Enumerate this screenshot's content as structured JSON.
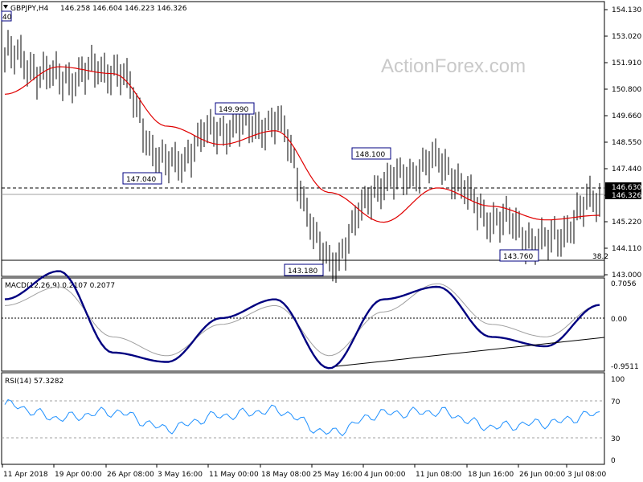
{
  "header": {
    "symbol": "GBPJPY,H4",
    "ohlc": "146.258 146.604 146.223 146.326",
    "corner_label": "40"
  },
  "watermark": "ActionForex.com",
  "colors": {
    "candles": "#000000",
    "moving_average": "#e00000",
    "macd_line": "#000080",
    "macd_signal": "#a0a0a0",
    "rsi_line": "#1e90ff",
    "label_box_border": "#000080",
    "price_box": "#000000"
  },
  "price_panel": {
    "price_axis_ticks": [
      "154.130",
      "153.020",
      "151.910",
      "150.800",
      "149.660",
      "148.550",
      "147.440",
      "146.330",
      "145.220",
      "144.110",
      "143.000"
    ],
    "current_price_high": "146.630",
    "current_price": "146.326",
    "annotations": [
      "149.990",
      "147.040",
      "148.100",
      "143.180",
      "143.760"
    ],
    "level_label": "38.2"
  },
  "macd_panel": {
    "title": "MACD(12,26,9) 0.2107 0.2077",
    "axis_ticks": [
      "0.7056",
      "0.00",
      "-0.9511"
    ]
  },
  "rsi_panel": {
    "title": "RSI(14) 57.3282",
    "axis_ticks": [
      "100",
      "70",
      "30",
      "0"
    ]
  },
  "time_axis": [
    "11 Apr 2018",
    "19 Apr 00:00",
    "26 Apr 08:00",
    "3 May 16:00",
    "11 May 00:00",
    "18 May 08:00",
    "25 May 16:00",
    "4 Jun 00:00",
    "11 Jun 08:00",
    "18 Jun 16:00",
    "26 Jun 00:00",
    "3 Jul 08:00"
  ],
  "chart_data": [
    {
      "type": "line",
      "title": "GBPJPY,H4",
      "description_values": "approximate closing path read from candles",
      "x": [
        "11 Apr 2018",
        "19 Apr 00:00",
        "26 Apr 08:00",
        "3 May 16:00",
        "11 May 00:00",
        "18 May 08:00",
        "25 May 16:00",
        "4 Jun 00:00",
        "11 Jun 08:00",
        "18 Jun 16:00",
        "26 Jun 00:00",
        "3 Jul 08:00"
      ],
      "series": [
        {
          "name": "price",
          "values": [
            152.6,
            151.6,
            152.0,
            147.8,
            149.4,
            149.6,
            143.6,
            147.0,
            147.9,
            145.5,
            144.4,
            146.3
          ]
        },
        {
          "name": "MA",
          "values": [
            150.9,
            152.1,
            151.8,
            149.5,
            148.7,
            149.3,
            146.6,
            145.3,
            146.8,
            146.0,
            145.4,
            145.6
          ]
        }
      ],
      "ylim": [
        143.0,
        154.6
      ]
    },
    {
      "type": "line",
      "title": "MACD(12,26,9) 0.2107 0.2077",
      "x": [
        "11 Apr 2018",
        "19 Apr 00:00",
        "26 Apr 08:00",
        "3 May 16:00",
        "11 May 00:00",
        "18 May 08:00",
        "25 May 16:00",
        "4 Jun 00:00",
        "11 Jun 08:00",
        "18 Jun 16:00",
        "26 Jun 00:00",
        "3 Jul 08:00"
      ],
      "series": [
        {
          "name": "MACD",
          "values": [
            0.3,
            0.75,
            -0.55,
            -0.7,
            0.0,
            0.3,
            -0.8,
            0.3,
            0.5,
            -0.3,
            -0.45,
            0.21
          ]
        },
        {
          "name": "signal",
          "values": [
            0.2,
            0.5,
            -0.3,
            -0.6,
            -0.1,
            0.2,
            -0.6,
            0.1,
            0.55,
            -0.1,
            -0.3,
            0.21
          ]
        }
      ],
      "ylim": [
        -1.0,
        0.75
      ]
    },
    {
      "type": "line",
      "title": "RSI(14) 57.3282",
      "x": [
        "11 Apr 2018",
        "19 Apr 00:00",
        "26 Apr 08:00",
        "3 May 16:00",
        "11 May 00:00",
        "18 May 08:00",
        "25 May 16:00",
        "4 Jun 00:00",
        "11 Jun 08:00",
        "18 Jun 16:00",
        "26 Jun 00:00",
        "3 Jul 08:00"
      ],
      "series": [
        {
          "name": "RSI",
          "values": [
            70,
            52,
            60,
            38,
            55,
            62,
            32,
            58,
            60,
            40,
            45,
            57.3
          ]
        }
      ],
      "ylim": [
        0,
        100
      ]
    }
  ]
}
